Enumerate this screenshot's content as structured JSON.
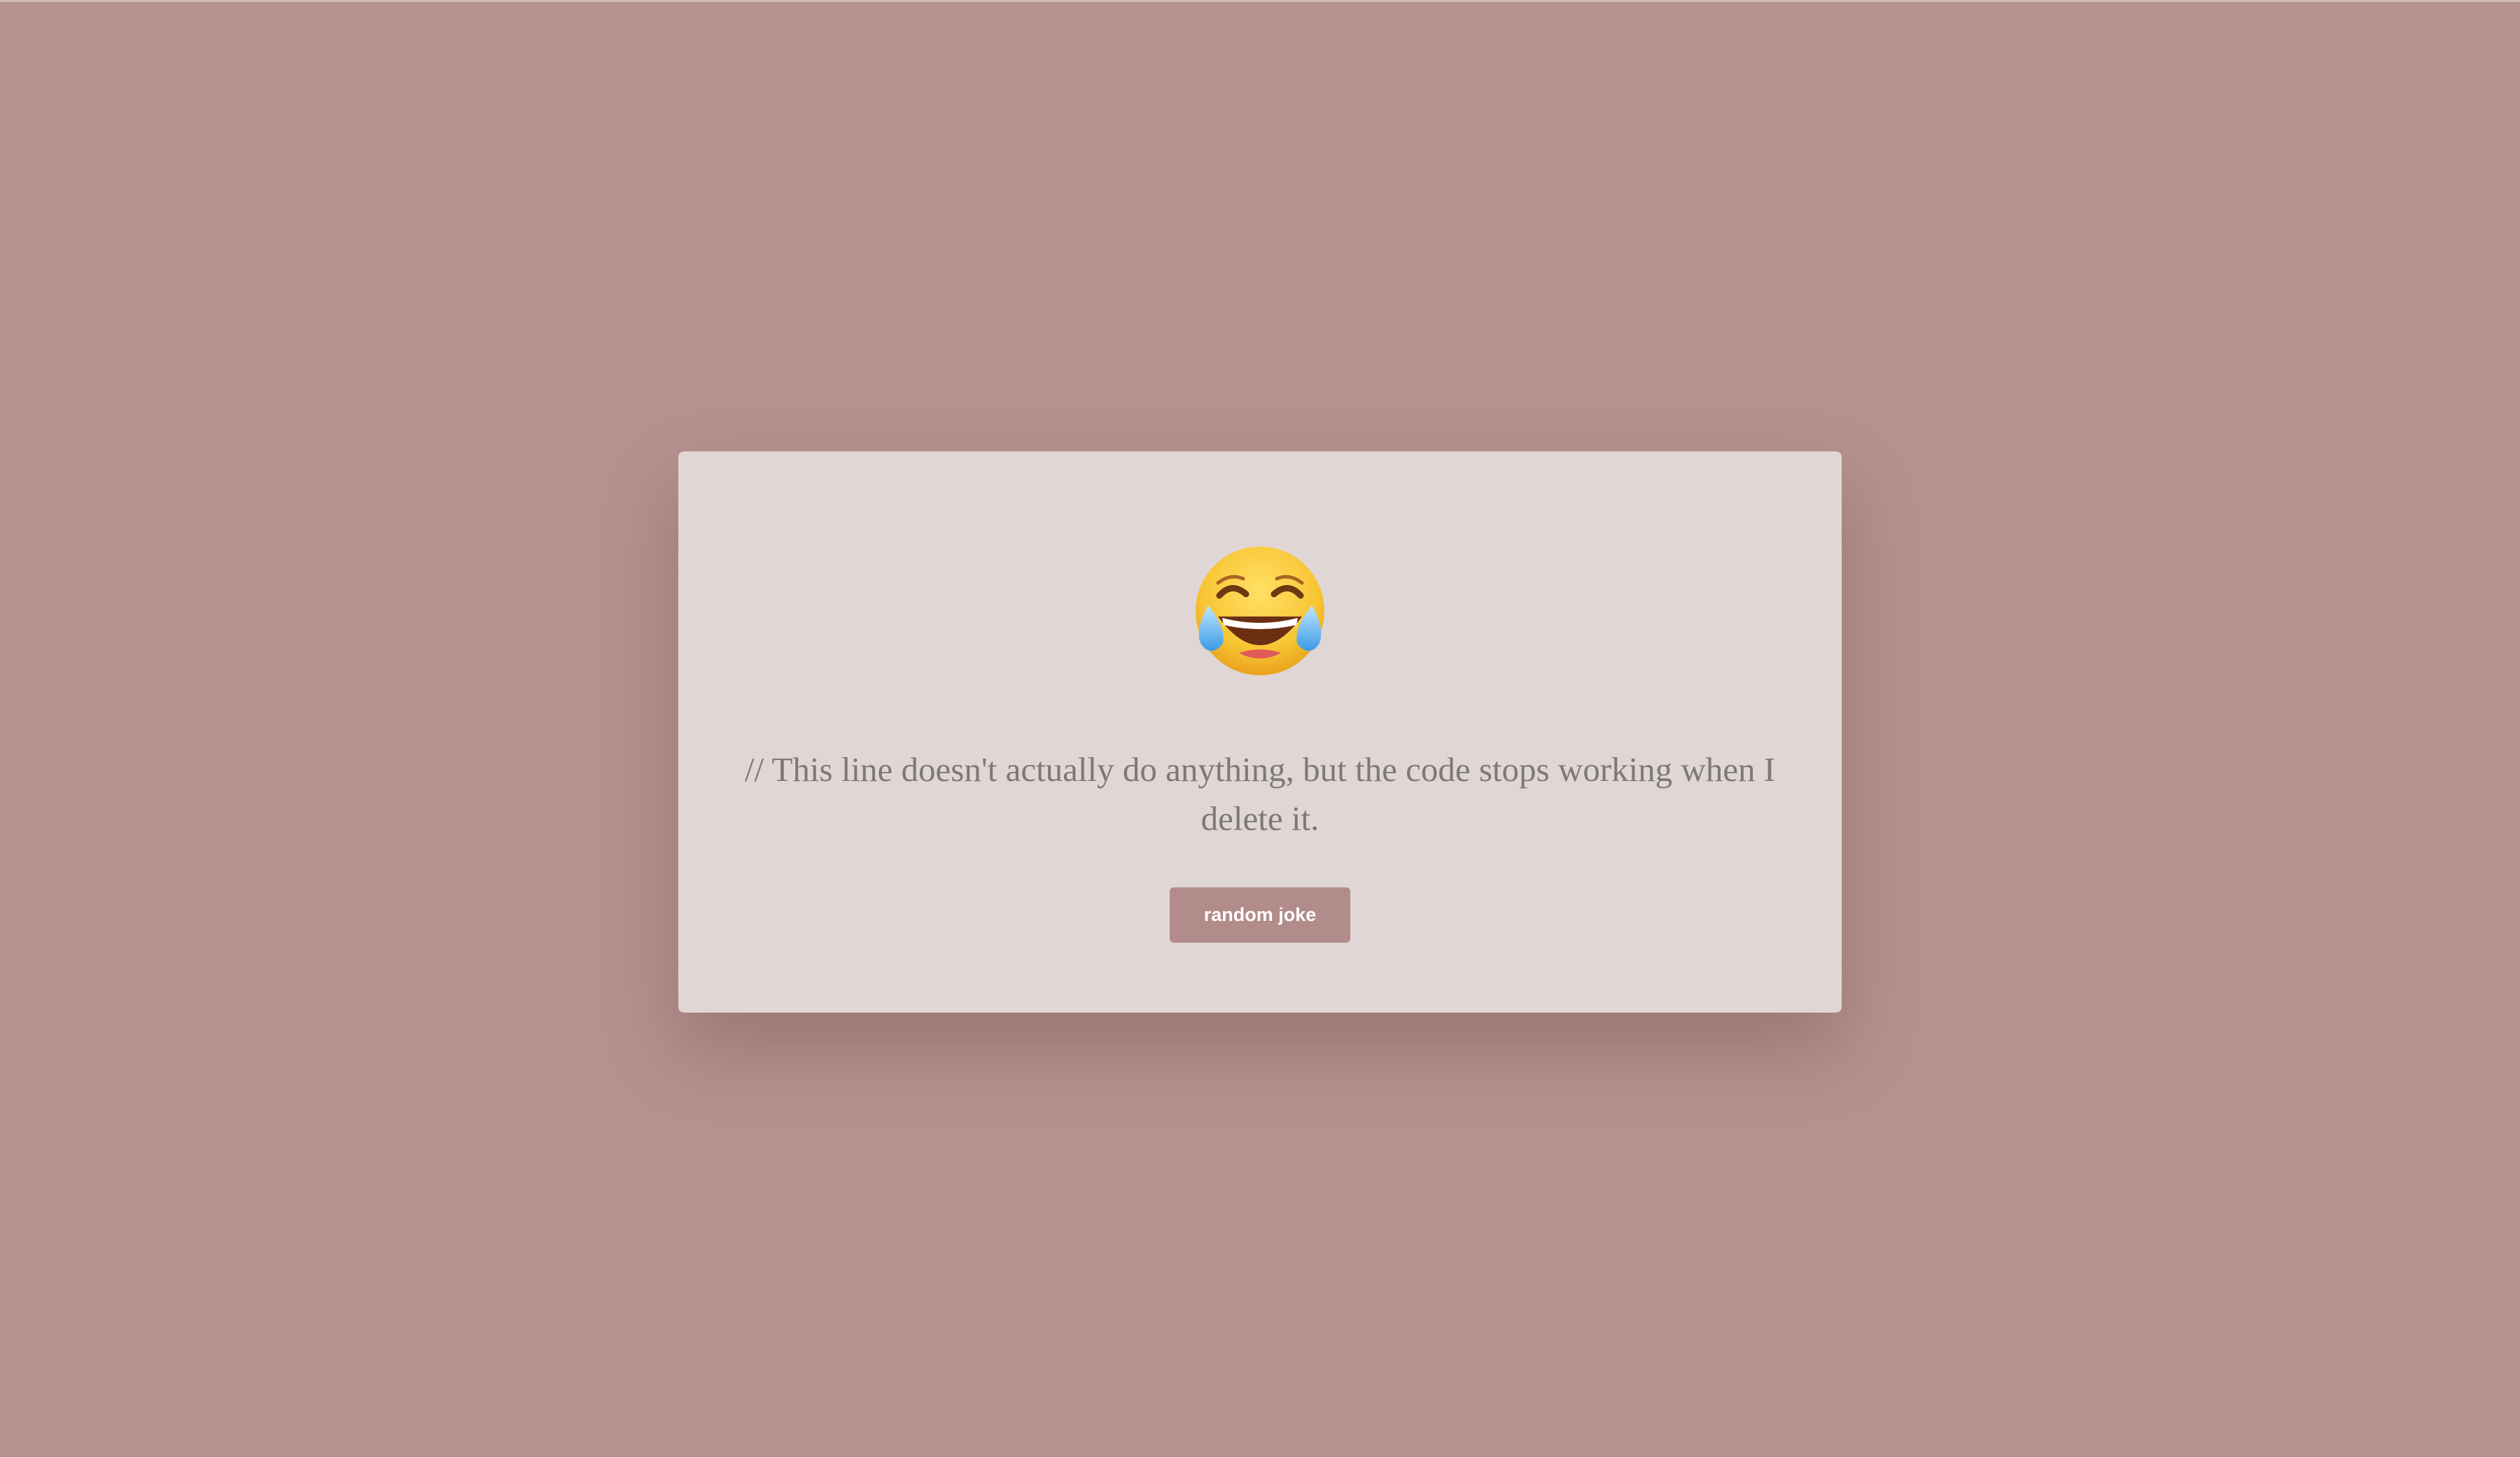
{
  "card": {
    "icon": "face-with-tears-of-joy-icon",
    "joke_text": "// This line doesn't actually do anything, but the code stops working when I delete it.",
    "button_label": "random joke"
  },
  "colors": {
    "background": "#b5928f",
    "card": "#e0d6d6",
    "text": "#7d7978",
    "button": "#b28c8a",
    "button_text": "#ffffff"
  }
}
